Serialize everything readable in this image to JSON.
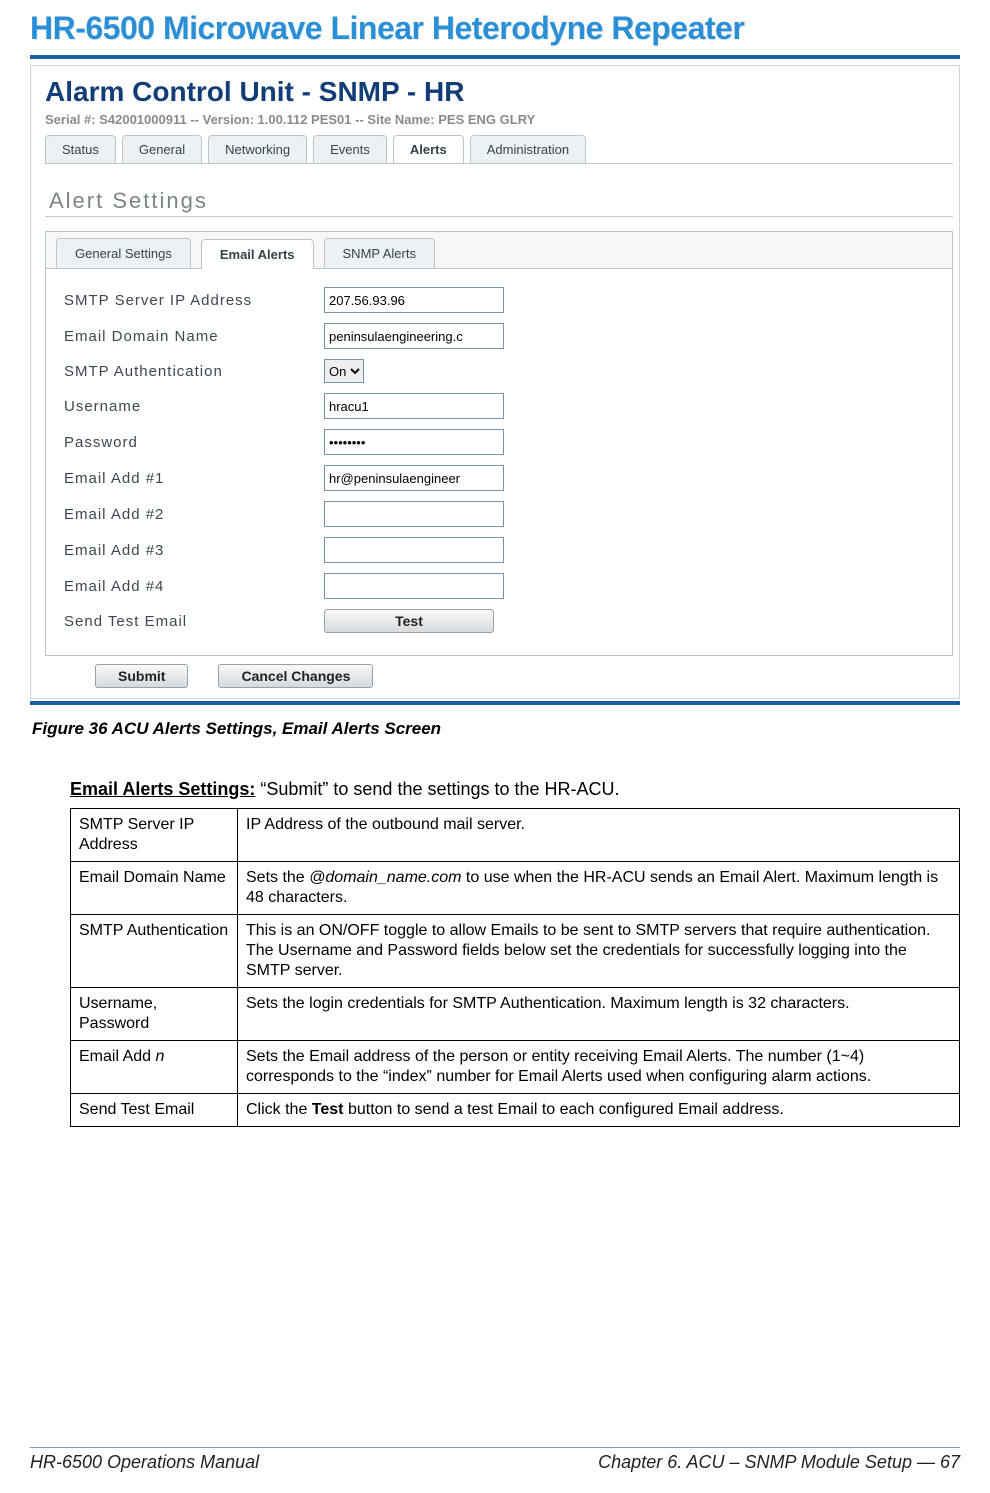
{
  "doc_title": "HR-6500 Microwave Linear Heterodyne Repeater",
  "screenshot": {
    "app_title": "Alarm Control Unit - SNMP - HR",
    "meta_serial_label": "Serial #:",
    "meta_serial": "S42001000911",
    "meta_version_label": "Version:",
    "meta_version": "1.00.112 PES01",
    "meta_site_label": "Site Name:",
    "meta_site": "PES ENG GLRY",
    "meta_sep": "   --   ",
    "main_tabs": [
      "Status",
      "General",
      "Networking",
      "Events",
      "Alerts",
      "Administration"
    ],
    "main_selected": 4,
    "section_title": "Alert Settings",
    "sub_tabs": [
      "General Settings",
      "Email Alerts",
      "SNMP Alerts"
    ],
    "sub_selected": 1,
    "fields": {
      "smtp_ip": {
        "label": "SMTP Server IP Address",
        "value": "207.56.93.96"
      },
      "domain": {
        "label": "Email Domain Name",
        "value": "peninsulaengineering.c"
      },
      "auth": {
        "label": "SMTP Authentication",
        "value": "On"
      },
      "user": {
        "label": "Username",
        "value": "hracu1"
      },
      "pass": {
        "label": "Password",
        "value": "••••••••"
      },
      "email1": {
        "label": "Email Add #1",
        "value": "hr@peninsulaengineer"
      },
      "email2": {
        "label": "Email Add #2",
        "value": ""
      },
      "email3": {
        "label": "Email Add #3",
        "value": ""
      },
      "email4": {
        "label": "Email Add #4",
        "value": ""
      },
      "sendtest": {
        "label": "Send Test Email",
        "button": "Test"
      }
    },
    "submit_label": "Submit",
    "cancel_label": "Cancel Changes"
  },
  "figure_caption": "Figure 36  ACU Alerts Settings, Email Alerts Screen",
  "settings_heading": "Email Alerts Settings:",
  "settings_tail": " “Submit” to send the settings to the HR-ACU.",
  "table": [
    {
      "k": "SMTP Server IP Address",
      "v": "IP Address of the outbound mail server."
    },
    {
      "k": "Email Domain Name",
      "v_pre": "Sets the ",
      "v_ital": "@domain_name.com",
      "v_post": " to use when the HR-ACU sends an Email Alert. Maximum length is 48 characters."
    },
    {
      "k": "SMTP Authentication",
      "v": "This is an ON/OFF toggle to allow Emails to be sent to SMTP servers that require authentication. The Username and Password fields below set the credentials for successfully logging into the SMTP server."
    },
    {
      "k": "Username, Password",
      "v": "Sets the login credentials for SMTP Authentication. Maximum length is 32 characters."
    },
    {
      "k_pre": "Email Add ",
      "k_ital": "n",
      "v": "Sets the Email address of the person or entity receiving Email Alerts. The number (1~4) corresponds to the “index” number for Email Alerts used when configuring alarm actions."
    },
    {
      "k": "Send Test Email",
      "v_pre": "Click the ",
      "v_bold": "Test",
      "v_post": " button to send a test Email to each configured Email address."
    }
  ],
  "footer_left": "HR-6500 Operations Manual",
  "footer_right": "Chapter 6. ACU – SNMP Module Setup — 67"
}
